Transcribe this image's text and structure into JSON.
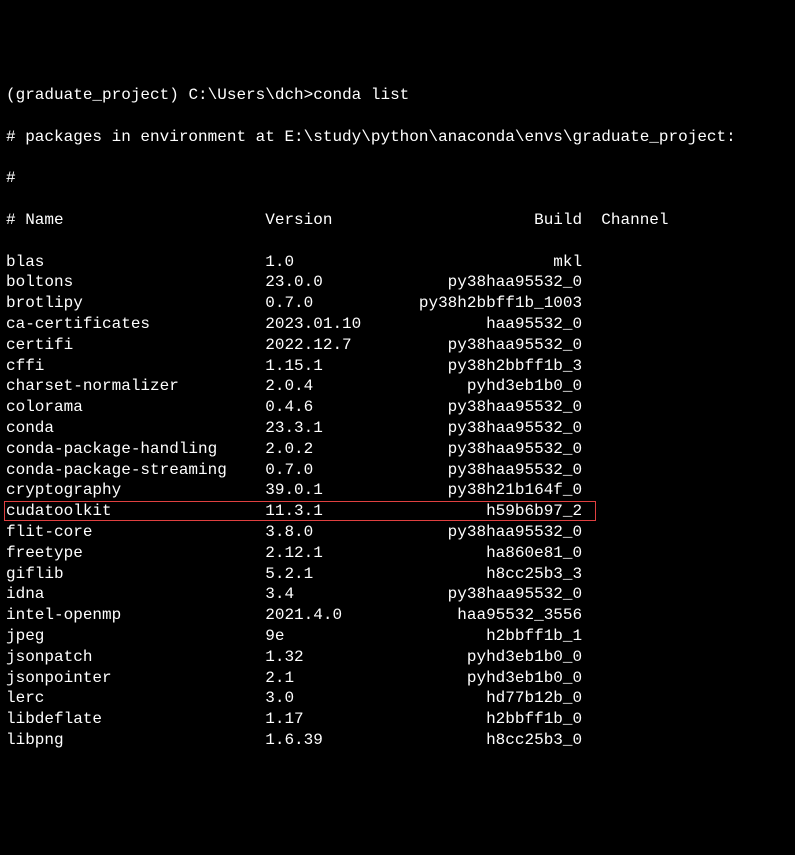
{
  "prompt": {
    "env": "(graduate_project)",
    "path": "C:\\Users\\dch>",
    "command": "conda list"
  },
  "env_line": "# packages in environment at E:\\study\\python\\anaconda\\envs\\graduate_project:",
  "hash_line": "#",
  "header": {
    "name": "# Name",
    "version": "Version",
    "build": "Build",
    "channel": "Channel"
  },
  "packages": [
    {
      "name": "blas",
      "version": "1.0",
      "build": "mkl",
      "highlighted": false
    },
    {
      "name": "boltons",
      "version": "23.0.0",
      "build": "py38haa95532_0",
      "highlighted": false
    },
    {
      "name": "brotlipy",
      "version": "0.7.0",
      "build": "py38h2bbff1b_1003",
      "highlighted": false
    },
    {
      "name": "ca-certificates",
      "version": "2023.01.10",
      "build": "haa95532_0",
      "highlighted": false
    },
    {
      "name": "certifi",
      "version": "2022.12.7",
      "build": "py38haa95532_0",
      "highlighted": false
    },
    {
      "name": "cffi",
      "version": "1.15.1",
      "build": "py38h2bbff1b_3",
      "highlighted": false
    },
    {
      "name": "charset-normalizer",
      "version": "2.0.4",
      "build": "pyhd3eb1b0_0",
      "highlighted": false
    },
    {
      "name": "colorama",
      "version": "0.4.6",
      "build": "py38haa95532_0",
      "highlighted": false
    },
    {
      "name": "conda",
      "version": "23.3.1",
      "build": "py38haa95532_0",
      "highlighted": false
    },
    {
      "name": "conda-package-handling",
      "version": "2.0.2",
      "build": "py38haa95532_0",
      "highlighted": false
    },
    {
      "name": "conda-package-streaming",
      "version": "0.7.0",
      "build": "py38haa95532_0",
      "highlighted": false
    },
    {
      "name": "cryptography",
      "version": "39.0.1",
      "build": "py38h21b164f_0",
      "highlighted": false
    },
    {
      "name": "cudatoolkit",
      "version": "11.3.1",
      "build": "h59b6b97_2",
      "highlighted": true
    },
    {
      "name": "flit-core",
      "version": "3.8.0",
      "build": "py38haa95532_0",
      "highlighted": false
    },
    {
      "name": "freetype",
      "version": "2.12.1",
      "build": "ha860e81_0",
      "highlighted": false
    },
    {
      "name": "giflib",
      "version": "5.2.1",
      "build": "h8cc25b3_3",
      "highlighted": false
    },
    {
      "name": "idna",
      "version": "3.4",
      "build": "py38haa95532_0",
      "highlighted": false
    },
    {
      "name": "intel-openmp",
      "version": "2021.4.0",
      "build": "haa95532_3556",
      "highlighted": false
    },
    {
      "name": "jpeg",
      "version": "9e",
      "build": "h2bbff1b_1",
      "highlighted": false
    },
    {
      "name": "jsonpatch",
      "version": "1.32",
      "build": "pyhd3eb1b0_0",
      "highlighted": false
    },
    {
      "name": "jsonpointer",
      "version": "2.1",
      "build": "pyhd3eb1b0_0",
      "highlighted": false
    },
    {
      "name": "lerc",
      "version": "3.0",
      "build": "hd77b12b_0",
      "highlighted": false
    },
    {
      "name": "libdeflate",
      "version": "1.17",
      "build": "h2bbff1b_0",
      "highlighted": false
    },
    {
      "name": "libpng",
      "version": "1.6.39",
      "build": "h8cc25b3_0",
      "highlighted": false
    }
  ]
}
